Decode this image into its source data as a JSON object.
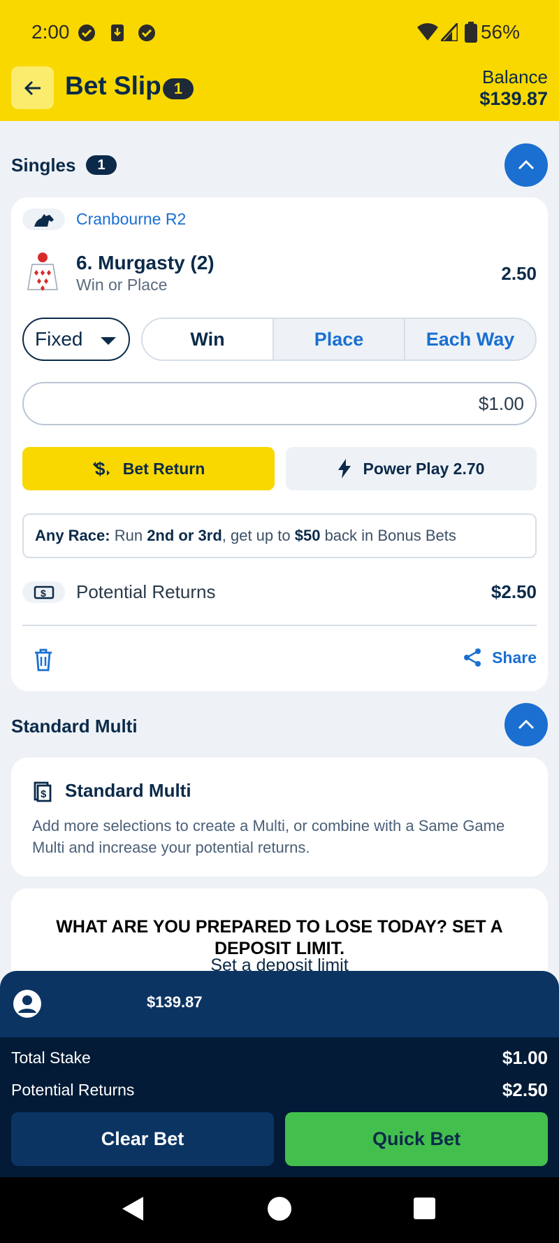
{
  "status_bar": {
    "time": "2:00",
    "battery": "56%"
  },
  "header": {
    "title": "Bet Slip",
    "badge": "1",
    "balance_label": "Balance",
    "balance_value": "$139.87"
  },
  "singles": {
    "title": "Singles",
    "count": "1",
    "bet": {
      "venue": "Cranbourne R2",
      "runner": "6. Murgasty (2)",
      "bet_type": "Win or Place",
      "odds": "2.50",
      "price_type": "Fixed",
      "options": [
        "Win",
        "Place",
        "Each Way"
      ],
      "selected_option": "Win",
      "stake": "$1.00",
      "bet_return_label": "Bet Return",
      "power_play_label": "Power Play 2.70",
      "promo": {
        "prefix": "Any Race:",
        "t1": " Run ",
        "b1": "2nd or 3rd",
        "t2": ", get up to ",
        "b2": "$50",
        "t3": " back in Bonus Bets"
      },
      "potential_returns_label": "Potential Returns",
      "potential_returns_value": "$2.50",
      "share_label": "Share"
    }
  },
  "multi": {
    "section_title": "Standard Multi",
    "card_title": "Standard Multi",
    "description": "Add more selections to create a Multi, or combine with a Same Game Multi and increase your potential returns."
  },
  "responsible_gambling": {
    "heading": "WHAT ARE YOU PREPARED TO LOSE TODAY? SET A DEPOSIT LIMIT.",
    "link": "Set a deposit limit"
  },
  "footer": {
    "account_balance": "$139.87",
    "total_stake_label": "Total Stake",
    "total_stake_value": "$1.00",
    "potential_returns_label": "Potential Returns",
    "potential_returns_value": "$2.50",
    "clear_label": "Clear Bet",
    "quick_label": "Quick Bet"
  },
  "colors": {
    "brand_yellow": "#f9d800",
    "navy": "#0b2a4a",
    "accent_blue": "#1a6fd1",
    "go_green": "#43bf4d"
  }
}
